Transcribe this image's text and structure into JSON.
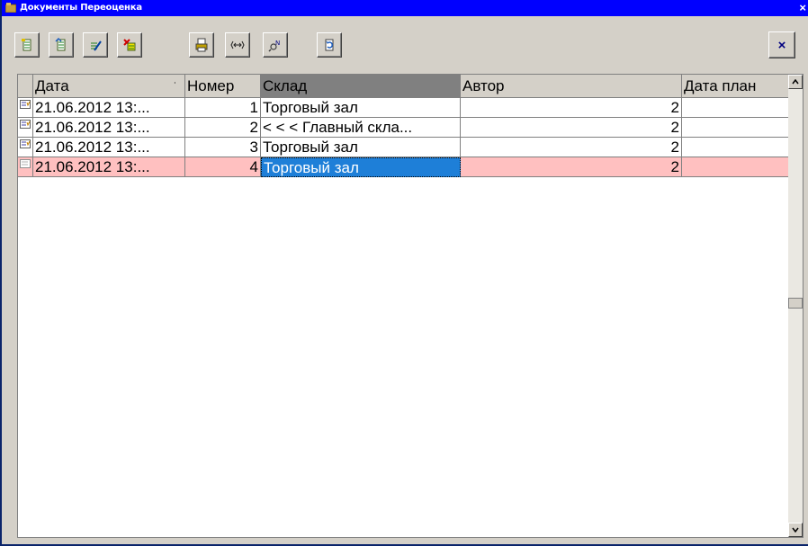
{
  "window": {
    "title": "Документы Переоценка",
    "close_glyph": "×"
  },
  "toolbar": {
    "buttons": [
      {
        "icon": "new-doc-icon"
      },
      {
        "icon": "copy-doc-icon"
      },
      {
        "icon": "edit-doc-icon"
      },
      {
        "icon": "delete-doc-icon"
      },
      {
        "icon": "print-icon"
      },
      {
        "icon": "column-width-icon"
      },
      {
        "icon": "search-icon"
      },
      {
        "icon": "refresh-icon"
      }
    ],
    "close_glyph": "×"
  },
  "table": {
    "columns": [
      "Дата",
      "Номер",
      "Склад",
      "Автор",
      "Дата план"
    ],
    "sort_indicator": "˙",
    "rows": [
      {
        "date": "21.06.2012 13:...",
        "number": "1",
        "warehouse": "Торговый зал",
        "author": "2",
        "plan_date": ""
      },
      {
        "date": "21.06.2012 13:...",
        "number": "2",
        "warehouse": "< < < Главный скла...",
        "author": "2",
        "plan_date": ""
      },
      {
        "date": "21.06.2012 13:...",
        "number": "3",
        "warehouse": "Торговый зал",
        "author": "2",
        "plan_date": ""
      },
      {
        "date": "21.06.2012 13:...",
        "number": "4",
        "warehouse": "Торговый зал",
        "author": "2",
        "plan_date": ""
      }
    ]
  },
  "colors": {
    "title_bg": "#0000ff",
    "selected_row": "#ffc0c0",
    "selected_cell": "#1e7fd8"
  }
}
